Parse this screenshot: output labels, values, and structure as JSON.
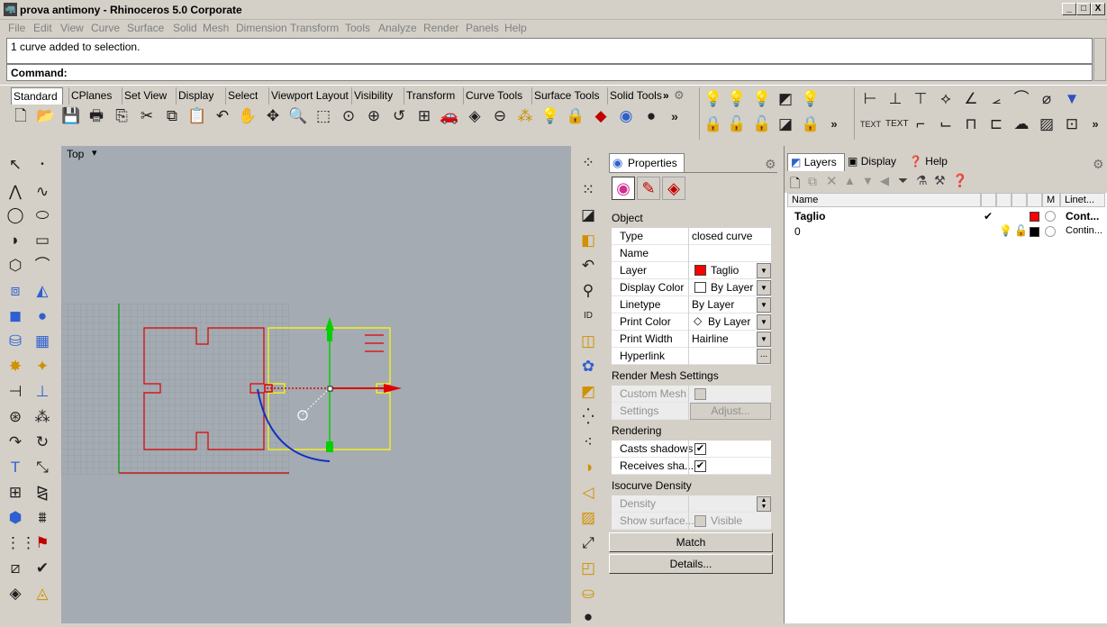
{
  "window": {
    "title": "prova antimony - Rhinoceros  5.0 Corporate",
    "minimize": "_",
    "restore": "□",
    "close": "X"
  },
  "menu": [
    "File",
    "Edit",
    "View",
    "Curve",
    "Surface",
    "Solid",
    "Mesh",
    "Dimension",
    "Transform",
    "Tools",
    "Analyze",
    "Render",
    "Panels",
    "Help"
  ],
  "history": {
    "text": "1 curve added to selection."
  },
  "command": {
    "label": "Command:",
    "value": ""
  },
  "toolbar_tabs": [
    "Standard",
    "CPlanes",
    "Set View",
    "Display",
    "Select",
    "Viewport Layout",
    "Visibility",
    "Transform",
    "Curve Tools",
    "Surface Tools",
    "Solid Tools"
  ],
  "toolbar_tabs_more": "»",
  "viewport": {
    "label": "Top",
    "dropdown": "▾"
  },
  "properties": {
    "tab_label": "Properties",
    "section_object": "Object",
    "rows": [
      {
        "label": "Type",
        "value": "closed curve"
      },
      {
        "label": "Name",
        "value": ""
      },
      {
        "label": "Layer",
        "value": "Taglio"
      },
      {
        "label": "Display Color",
        "value": "By Layer"
      },
      {
        "label": "Linetype",
        "value": "By Layer"
      },
      {
        "label": "Print Color",
        "value": "By Layer"
      },
      {
        "label": "Print Width",
        "value": "Hairline"
      },
      {
        "label": "Hyperlink",
        "value": "..."
      }
    ],
    "section_render_mesh": "Render Mesh Settings",
    "custom_mesh_label": "Custom Mesh",
    "settings_label": "Settings",
    "adjust_button": "Adjust...",
    "section_rendering": "Rendering",
    "casts_shadows_label": "Casts shadows",
    "receives_shadows_label": "Receives sha...",
    "casts_shadows_checked": "✔",
    "receives_shadows_checked": "✔",
    "section_isocurve": "Isocurve Density",
    "density_label": "Density",
    "show_surface_label": "Show surface...",
    "visible_label": "Visible",
    "match_button": "Match",
    "details_button": "Details..."
  },
  "layers_panel": {
    "tabs": [
      "Layers",
      "Display",
      "Help"
    ],
    "columns": [
      "Name",
      "M",
      "Linet..."
    ],
    "rows": [
      {
        "name": "Taglio",
        "check": "✔",
        "linetype": "Cont...",
        "color": "#ff0000"
      },
      {
        "name": "0",
        "check": "",
        "linetype": "Contin...",
        "color": "#000000"
      }
    ]
  },
  "colors": {
    "layer_taglio": "#ff0000",
    "viewport_bg": "#a4abb3",
    "selection": "#ffff00",
    "gumball_x": "#ff0000",
    "gumball_y": "#00cc00"
  }
}
